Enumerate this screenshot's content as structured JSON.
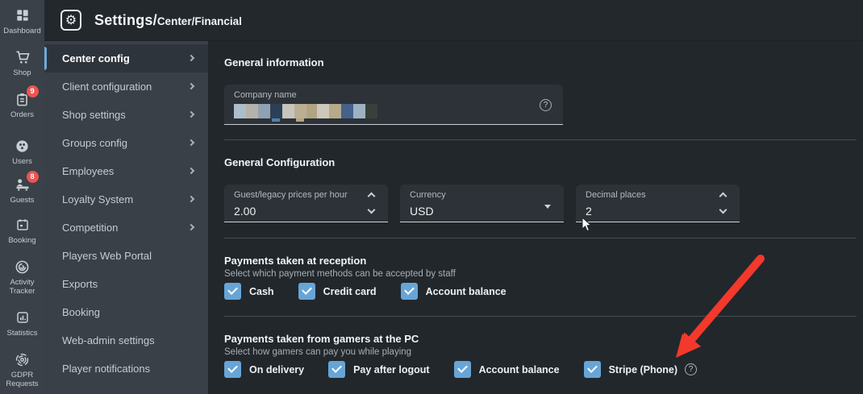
{
  "header": {
    "title_primary": "Settings/",
    "title_secondary": "Center/Financial"
  },
  "glyphs": {
    "gear": "⚙",
    "question": "?"
  },
  "colors": {
    "background": "#22272c",
    "rail": "#3a4149",
    "sidebar": "#394047",
    "selected_item": "#2e343b",
    "accent_blue": "#71aad8",
    "checkbox_blue": "#67a5d7",
    "badge_red": "#ef5350",
    "annotation_arrow_red": "#f2392c",
    "field_background": "#2c3237",
    "divider": "#474d53",
    "text_primary": "#f2f4f6"
  },
  "rail": {
    "items": [
      {
        "label": "Dashboard",
        "icon": "dashboard-icon"
      },
      {
        "label": "Shop",
        "icon": "cart-icon"
      },
      {
        "label": "Orders",
        "icon": "clipboard-icon",
        "badge": "9"
      },
      {
        "label": "Users",
        "icon": "users-icon"
      },
      {
        "label": "Guests",
        "icon": "guests-icon",
        "badge": "8"
      },
      {
        "label": "Booking",
        "icon": "calendar-icon"
      },
      {
        "label": "Activity\nTracker",
        "icon": "activity-icon"
      },
      {
        "label": "Statistics",
        "icon": "statistics-icon"
      },
      {
        "label": "GDPR\nRequests",
        "icon": "fingerprint-icon"
      }
    ]
  },
  "sidebar": {
    "items": [
      {
        "label": "Center config",
        "expandable": true,
        "selected": true
      },
      {
        "label": "Client configuration",
        "expandable": true,
        "selected": false
      },
      {
        "label": "Shop settings",
        "expandable": true,
        "selected": false
      },
      {
        "label": "Groups config",
        "expandable": true,
        "selected": false
      },
      {
        "label": "Employees",
        "expandable": true,
        "selected": false
      },
      {
        "label": "Loyalty System",
        "expandable": true,
        "selected": false
      },
      {
        "label": "Competition",
        "expandable": true,
        "selected": false
      },
      {
        "label": "Players Web Portal",
        "expandable": false,
        "selected": false
      },
      {
        "label": "Exports",
        "expandable": false,
        "selected": false
      },
      {
        "label": "Booking",
        "expandable": false,
        "selected": false
      },
      {
        "label": "Web-admin settings",
        "expandable": false,
        "selected": false
      },
      {
        "label": "Player notifications",
        "expandable": false,
        "selected": false
      }
    ]
  },
  "main": {
    "section_general_info": {
      "title": "General information",
      "company_field": {
        "label": "Company name",
        "value_redacted": true,
        "redaction_blocks": [
          {
            "color": "#adbeca",
            "w": 15
          },
          {
            "color": "#b5b2ab",
            "w": 15
          },
          {
            "color": "#8fa2b2",
            "w": 15
          },
          {
            "color": "#2c3f58",
            "w": 15,
            "tab": "#4e82ab"
          },
          {
            "color": "#c6c5bd",
            "w": 15
          },
          {
            "color": "#bcae92",
            "w": 15,
            "tab": "#b3a584"
          },
          {
            "color": "#b2a483",
            "w": 13
          },
          {
            "color": "#ccc9ba",
            "w": 15
          },
          {
            "color": "#b7a98a",
            "w": 15
          },
          {
            "color": "#45628c",
            "w": 15
          },
          {
            "color": "#9db3c3",
            "w": 15
          },
          {
            "color": "#3a3f3c",
            "w": 15
          }
        ]
      }
    },
    "section_general_config": {
      "title": "General Configuration",
      "fields": [
        {
          "label": "Guest/legacy prices per hour",
          "value": "2.00",
          "type": "stepper"
        },
        {
          "label": "Currency",
          "value": "USD",
          "type": "select"
        },
        {
          "label": "Decimal places",
          "value": "2",
          "type": "stepper"
        }
      ]
    },
    "section_reception": {
      "title": "Payments taken at reception",
      "subtitle": "Select which payment methods can be accepted by staff",
      "options": [
        {
          "label": "Cash",
          "checked": true
        },
        {
          "label": "Credit card",
          "checked": true
        },
        {
          "label": "Account balance",
          "checked": true
        }
      ]
    },
    "section_pc": {
      "title": "Payments taken from gamers at the PC",
      "subtitle": "Select how gamers can pay you while playing",
      "options": [
        {
          "label": "On delivery",
          "checked": true
        },
        {
          "label": "Pay after logout",
          "checked": true
        },
        {
          "label": "Account balance",
          "checked": true
        },
        {
          "label": "Stripe (Phone)",
          "checked": true,
          "help": true
        }
      ]
    }
  },
  "annotations": {
    "red_arrow_target": "Stripe (Phone) checkbox"
  }
}
